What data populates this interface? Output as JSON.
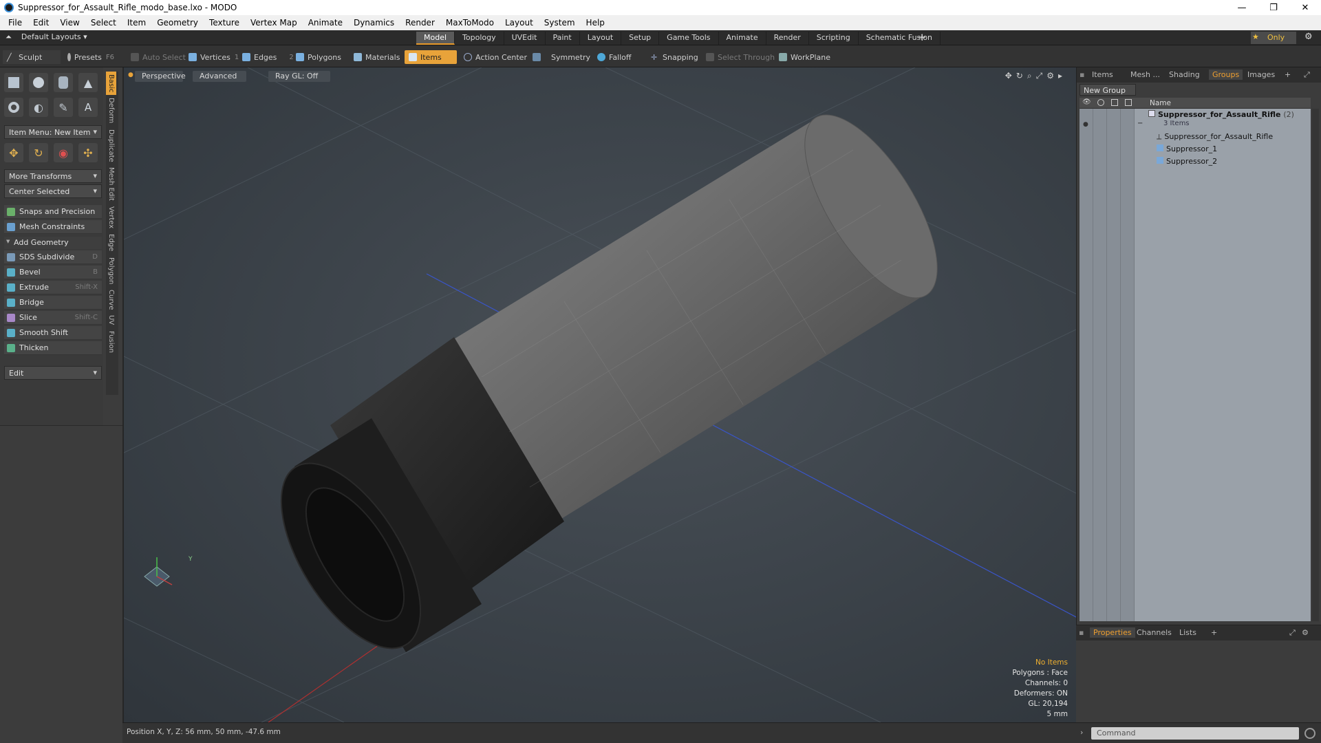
{
  "window": {
    "title": "Suppressor_for_Assault_Rifle_modo_base.lxo - MODO",
    "minimize": "—",
    "restore": "❐",
    "close": "✕"
  },
  "menu": [
    "File",
    "Edit",
    "View",
    "Select",
    "Item",
    "Geometry",
    "Texture",
    "Vertex Map",
    "Animate",
    "Dynamics",
    "Render",
    "MaxToModo",
    "Layout",
    "System",
    "Help"
  ],
  "layoutbar": {
    "default_layouts": "Default Layouts ▾",
    "tabs": [
      "Model",
      "Topology",
      "UVEdit",
      "Paint",
      "Layout",
      "Setup",
      "Game Tools",
      "Animate",
      "Render",
      "Scripting",
      "Schematic Fusion"
    ],
    "active_tab": "Model",
    "plus": "+",
    "only": "Only"
  },
  "toolbar": {
    "sculpt": "Sculpt",
    "presets": "Presets",
    "presets_key": "F6",
    "auto_select": "Auto Select",
    "vertices": "Vertices",
    "vertices_key": "1",
    "edges": "Edges",
    "edges_key": "2",
    "polygons": "Polygons",
    "materials": "Materials",
    "items": "Items",
    "action_center": "Action Center",
    "symmetry": "Symmetry",
    "falloff": "Falloff",
    "snapping": "Snapping",
    "select_through": "Select Through",
    "workplane": "WorkPlane"
  },
  "toolbox": {
    "item_menu": "Item Menu: New Item",
    "more_transforms": "More Transforms",
    "center_selected": "Center Selected",
    "snaps": "Snaps and Precision",
    "mesh_constraints": "Mesh Constraints",
    "add_geometry": "Add Geometry",
    "tools": [
      {
        "label": "SDS Subdivide",
        "key": "D"
      },
      {
        "label": "Bevel",
        "key": "B"
      },
      {
        "label": "Extrude",
        "key": "Shift-X"
      },
      {
        "label": "Bridge",
        "key": ""
      },
      {
        "label": "Slice",
        "key": "Shift-C"
      },
      {
        "label": "Smooth Shift",
        "key": ""
      },
      {
        "label": "Thicken",
        "key": ""
      }
    ],
    "edit": "Edit",
    "vtabs": [
      "Basic",
      "Deform",
      "Duplicate",
      "Mesh Edit",
      "Vertex",
      "Edge",
      "Polygon",
      "Curve",
      "UV",
      "Fusion"
    ]
  },
  "viewport": {
    "perspective": "Perspective",
    "advanced": "Advanced",
    "raygl": "Ray GL: Off",
    "hud": {
      "no_items": "No Items",
      "polygons": "Polygons : Face",
      "channels": "Channels: 0",
      "deformers": "Deformers: ON",
      "gl": "GL: 20,194",
      "scale": "5 mm"
    },
    "axis_y": "Y",
    "axis_x": "X"
  },
  "status": {
    "position": "Position X, Y, Z:  56 mm, 50 mm, -47.6 mm"
  },
  "rightpanel": {
    "tabs": [
      "Items",
      "Mesh ...",
      "Shading",
      "Groups",
      "Images"
    ],
    "active_tab": "Groups",
    "new_group": "New Group",
    "name_header": "Name",
    "group_name": "Suppressor_for_Assault_Rifle",
    "group_count": "(2)",
    "group_sub": "3 Items",
    "children": [
      "Suppressor_for_Assault_Rifle",
      "Suppressor_1",
      "Suppressor_2"
    ]
  },
  "props": {
    "tabs": [
      "Properties",
      "Channels",
      "Lists"
    ],
    "active_tab": "Properties"
  },
  "command": {
    "placeholder": "Command"
  },
  "colors": {
    "accent": "#e8a33a",
    "viewport_bg": "#3d444b",
    "list_bg": "#9aa1a9"
  }
}
